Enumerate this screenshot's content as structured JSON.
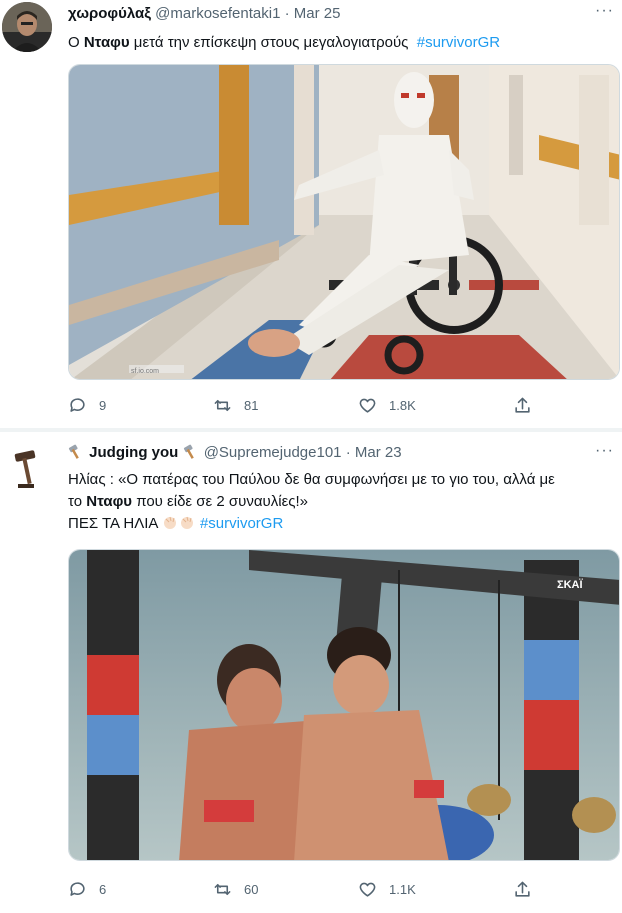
{
  "tweets": [
    {
      "display_name": "χωροφύλαξ",
      "handle": "@markosefentaki1",
      "date": "Mar 25",
      "more_label": "···",
      "text_before": "Ο ",
      "text_bold": "Νταφυ",
      "text_after": " μετά την επίσκεψη στους μεγαλογιατρούς  ",
      "hashtag": "#survivorGR",
      "replies": "9",
      "retweets": "81",
      "likes": "1.8K"
    },
    {
      "display_name": "Judging you",
      "handle": "@Supremejudge101",
      "date": "Mar 23",
      "more_label": "···",
      "line1_prefix": "Ηλίας : «Ο πατέρας του Παύλου δε θα συμφωνήσει με το γιο του, αλλά με",
      "line2_prefix": "το ",
      "line2_bold": "Νταφυ",
      "line2_suffix": " που είδε σε 2 συναυλίες!»",
      "line3_text": "ΠΕΣ ΤΑ ΗΛΙΑ",
      "hashtag": "#survivorGR",
      "replies": "6",
      "retweets": "60",
      "likes": "1.1K"
    }
  ],
  "media": {
    "tweet1_overlay": "sf.io.com",
    "tweet2_channel": "ΣΚΑΪ"
  },
  "icons": [
    "reply-icon",
    "retweet-icon",
    "like-icon",
    "share-icon",
    "hammer-icon",
    "clap-icon",
    "gavel-avatar"
  ],
  "colors": {
    "hashtag": "#1d9bf0",
    "secondary_text": "#536471",
    "primary_text": "#0f1419"
  }
}
